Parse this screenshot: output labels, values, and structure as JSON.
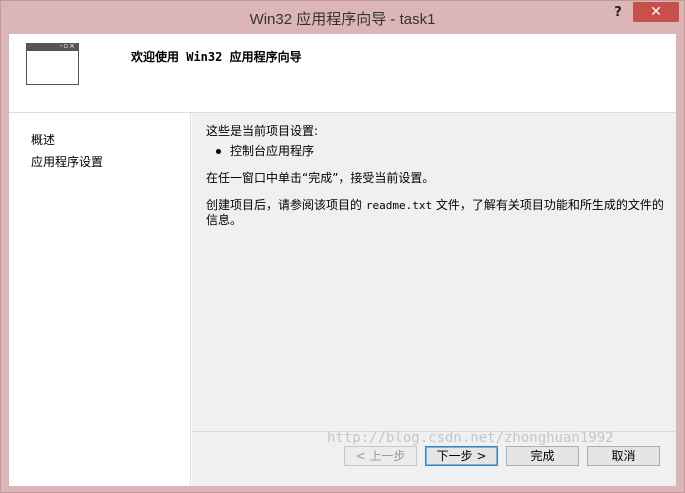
{
  "window": {
    "title": "Win32 应用程序向导 - task1",
    "help_label": "?",
    "close_label": "✕"
  },
  "banner": {
    "heading": "欢迎使用 Win32 应用程序向导"
  },
  "sidebar": {
    "items": [
      {
        "label": "概述"
      },
      {
        "label": "应用程序设置"
      }
    ]
  },
  "content": {
    "intro": "这些是当前项目设置:",
    "bullet": "控制台应用程序",
    "finish_hint": "在任一窗口中单击“完成”，接受当前设置。",
    "readme_before": "创建项目后，请参阅该项目的",
    "readme_file": "readme.txt",
    "readme_after": "文件，了解有关项目功能和所生成的文件的信息。"
  },
  "buttons": {
    "prev": "< 上一步",
    "next": "下一步 >",
    "finish": "完成",
    "cancel": "取消"
  },
  "watermark": "http://blog.csdn.net/zhonghuan1992",
  "colors": {
    "titlebar": "#dcb6b6",
    "close": "#c7504a"
  }
}
